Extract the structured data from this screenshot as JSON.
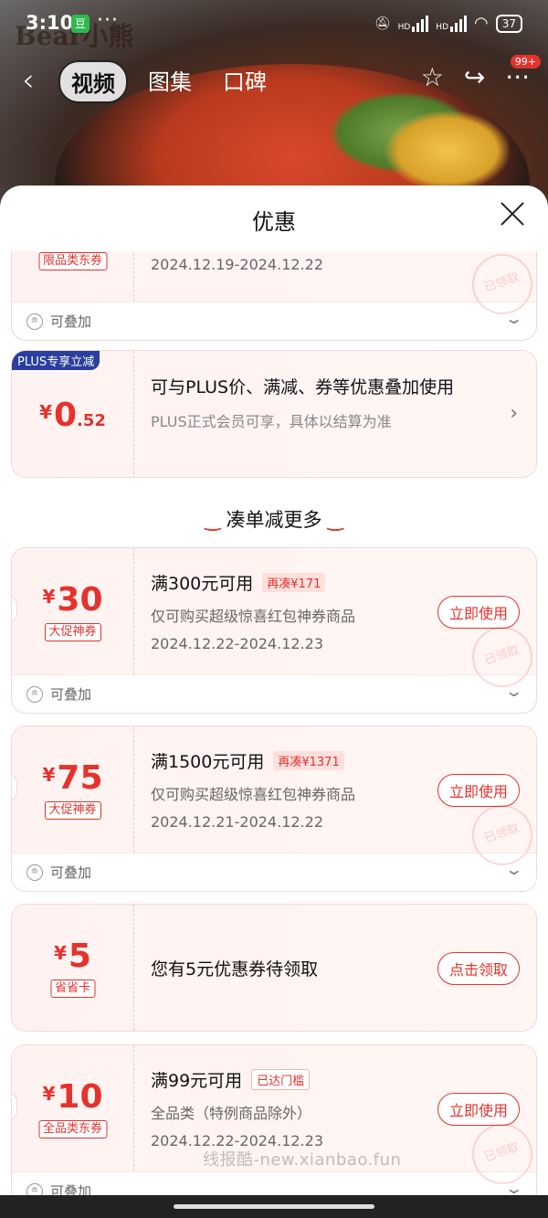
{
  "status_bar": {
    "time": "3:10",
    "app_icon_char": "豆",
    "dots": "···",
    "network_label": "HD",
    "battery": "37"
  },
  "nav": {
    "back_icon": "‹",
    "tabs": [
      {
        "label": "视频",
        "active": true
      },
      {
        "label": "图集",
        "active": false
      },
      {
        "label": "口碑",
        "active": false
      }
    ],
    "star_icon": "☆",
    "share_icon": "↪",
    "more_icon": "···",
    "badge": "99+"
  },
  "background": {
    "brand": "Bear小熊"
  },
  "sheet": {
    "title": "优惠"
  },
  "coupons_top": {
    "tag": "限品类东券",
    "date": "2024.12.19-2024.12.22",
    "stamp": "已领取",
    "stack_label": "可叠加",
    "stack_icon": "≘"
  },
  "plus": {
    "badge": "PLUS专享立减",
    "symbol": "¥",
    "integer": "0",
    "decimal": ".52",
    "title": "可与PLUS价、满减、券等优惠叠加使用",
    "sub": "PLUS正式会员可享，具体以结算为准",
    "arrow": "›"
  },
  "section": {
    "title": "凑单减更多",
    "smile": "‿"
  },
  "coupons": [
    {
      "symbol": "¥",
      "amount": "30",
      "tag": "大促神券",
      "title": "满300元可用",
      "pill": "再凑¥171",
      "sub": "仅可购买超级惊喜红包神券商品",
      "date": "2024.12.22-2024.12.23",
      "button": "立即使用",
      "stamp": "已领取",
      "stack_label": "可叠加"
    },
    {
      "symbol": "¥",
      "amount": "75",
      "tag": "大促神券",
      "title": "满1500元可用",
      "pill": "再凑¥1371",
      "sub": "仅可购买超级惊喜红包神券商品",
      "date": "2024.12.21-2024.12.22",
      "button": "立即使用",
      "stamp": "已领取",
      "stack_label": "可叠加"
    },
    {
      "symbol": "¥",
      "amount": "5",
      "tag": "省省卡",
      "title": "您有5元优惠券待领取",
      "button": "点击领取"
    },
    {
      "symbol": "¥",
      "amount": "10",
      "tag": "全品类东券",
      "title": "满99元可用",
      "pill": "已达门槛",
      "sub": "全品类（特例商品除外）",
      "date": "2024.12.22-2024.12.23",
      "button": "立即使用",
      "stamp": "已领取",
      "stack_label": "可叠加"
    }
  ],
  "watermark": "线报酷-new.xianbao.fun",
  "colors": {
    "accent": "#e5322d",
    "plus_badge": "#2a3f9e",
    "card_bg": "#fff3f1"
  }
}
